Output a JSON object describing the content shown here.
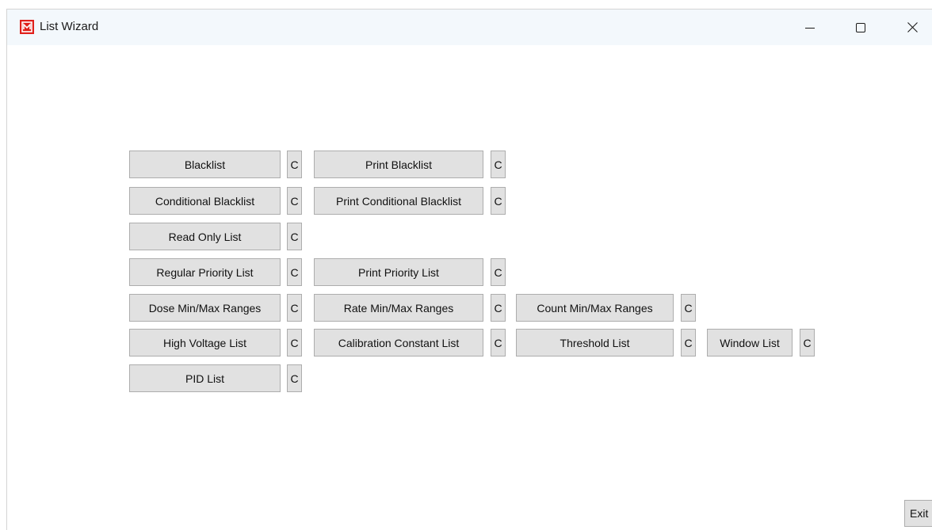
{
  "window": {
    "title": "List Wizard",
    "icon": "app-logo-icon",
    "controls": [
      "minimize-icon",
      "maximize-icon",
      "close-icon"
    ]
  },
  "clear_label": "C",
  "rows": [
    [
      {
        "label": "Blacklist"
      },
      {
        "label": "Print Blacklist"
      }
    ],
    [
      {
        "label": "Conditional Blacklist"
      },
      {
        "label": "Print Conditional Blacklist"
      }
    ],
    [
      {
        "label": "Read Only List"
      }
    ],
    [
      {
        "label": "Regular Priority List"
      },
      {
        "label": "Print Priority List"
      }
    ],
    [
      {
        "label": "Dose Min/Max Ranges"
      },
      {
        "label": "Rate Min/Max Ranges"
      },
      {
        "label": "Count Min/Max Ranges"
      }
    ],
    [
      {
        "label": "High Voltage List"
      },
      {
        "label": "Calibration Constant List"
      },
      {
        "label": "Threshold List"
      },
      {
        "label": "Window List"
      }
    ],
    [
      {
        "label": "PID List"
      }
    ]
  ],
  "exit_label": "Exit",
  "colors": {
    "titlebar": "#f3f8fc",
    "button_face": "#e1e1e1",
    "button_border": "#adadad",
    "icon_red": "#e0201b"
  }
}
